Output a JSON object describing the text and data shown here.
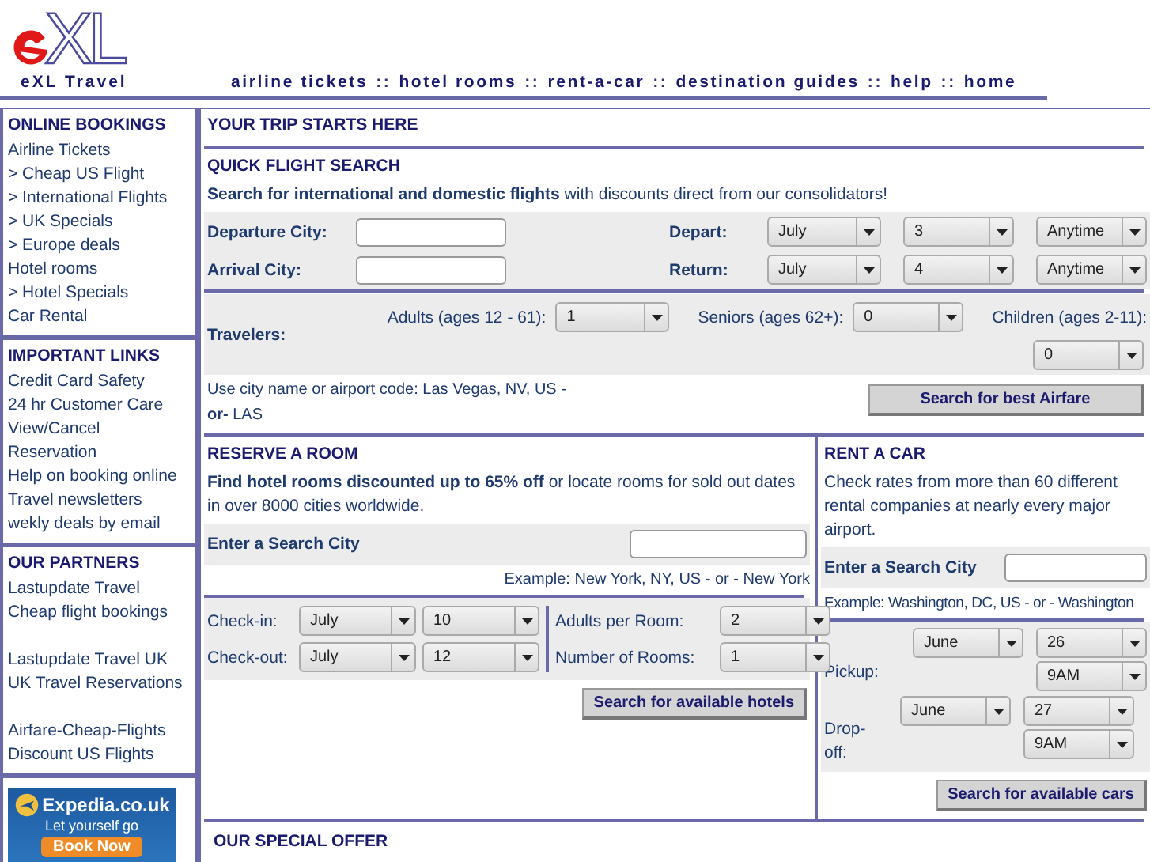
{
  "header": {
    "logo_letters": "XL",
    "site_name": "eXL Travel",
    "nav": [
      {
        "kind": "link",
        "text": "airline tickets"
      },
      {
        "kind": "separator",
        "text": "::"
      },
      {
        "kind": "link",
        "text": "hotel rooms"
      },
      {
        "kind": "separator",
        "text": "::"
      },
      {
        "kind": "link",
        "text": "rent-a-car"
      },
      {
        "kind": "separator",
        "text": "::"
      },
      {
        "kind": "link",
        "text": "destination guides"
      },
      {
        "kind": "separator",
        "text": "::"
      },
      {
        "kind": "link",
        "text": "help"
      },
      {
        "kind": "separator",
        "text": "::"
      },
      {
        "kind": "link",
        "text": "home"
      }
    ]
  },
  "sidebar": {
    "sections": [
      {
        "title": "ONLINE BOOKINGS",
        "groups": [
          [
            "Airline Tickets",
            "> Cheap US Flight",
            "> International Flights",
            "> UK Specials",
            "> Europe deals",
            "Hotel rooms",
            "> Hotel Specials",
            "Car Rental"
          ]
        ]
      },
      {
        "title": "IMPORTANT LINKS",
        "groups": [
          [
            "Credit Card Safety",
            "24 hr Customer Care",
            "View/Cancel",
            "Reservation",
            "Help on booking online",
            "Travel newsletters",
            "wekly deals by email"
          ]
        ]
      },
      {
        "title": "OUR PARTNERS",
        "groups": [
          [
            "Lastupdate Travel",
            "Cheap flight bookings"
          ],
          [
            "Lastupdate Travel UK",
            "UK Travel Reservations"
          ],
          [
            "Airfare-Cheap-Flights",
            "Discount US Flights"
          ]
        ]
      }
    ],
    "banner": {
      "brand": "Expedia.co.uk",
      "tagline": "Let yourself go",
      "button": "Book Now"
    }
  },
  "main": {
    "title": "YOUR TRIP STARTS HERE",
    "flight": {
      "title": "QUICK FLIGHT SEARCH",
      "intro": "**Search for international and domestic flights** with discounts direct from our consolidators!",
      "departure_label": "Departure City:",
      "arrival_label": "Arrival City:",
      "depart_label": "Depart:",
      "depart": [
        "July",
        "3",
        "Anytime"
      ],
      "return_label": "Return:",
      "return": [
        "July",
        "4",
        "Anytime"
      ],
      "travelers_label": "Travelers:",
      "adults_label": "Adults (ages 12 - 61):",
      "adults": "1",
      "seniors_label": "Seniors (ages 62+):",
      "seniors": "0",
      "children_label": "Children (ages 2-11):",
      "children": "0",
      "hint": "Use city name or airport code: Las Vegas, NV, US - **or-** LAS",
      "button": "Search for best Airfare"
    },
    "hotel": {
      "title": "RESERVE A ROOM",
      "intro": "**Find hotel rooms discounted up to 65% off** or locate rooms for sold out dates in over 8000 cities worldwide.",
      "city_label": "Enter a Search City",
      "example": "Example: New York, NY, US - or - New York",
      "checkin_label": "Check-in:",
      "checkin": [
        "July",
        "10"
      ],
      "checkout_label": "Check-out:",
      "checkout": [
        "July",
        "12"
      ],
      "adults_label": "Adults per Room:",
      "adults": "2",
      "rooms_label": "Number of Rooms:",
      "rooms": "1",
      "button": "Search for available hotels"
    },
    "car": {
      "title": "RENT A CAR",
      "intro": "Check rates from more than 60 different rental companies at nearly every major airport.",
      "city_label": "Enter a Search City",
      "example": "Example: Washington, DC, US - or - Washington",
      "pickup_label": "Pickup:",
      "pickup": [
        "June",
        "26",
        "9AM"
      ],
      "dropoff_label": "Drop-off:",
      "dropoff": [
        "June",
        "27",
        "9AM"
      ],
      "button": "Search for available cars"
    },
    "offer_title": "OUR SPECIAL OFFER"
  }
}
